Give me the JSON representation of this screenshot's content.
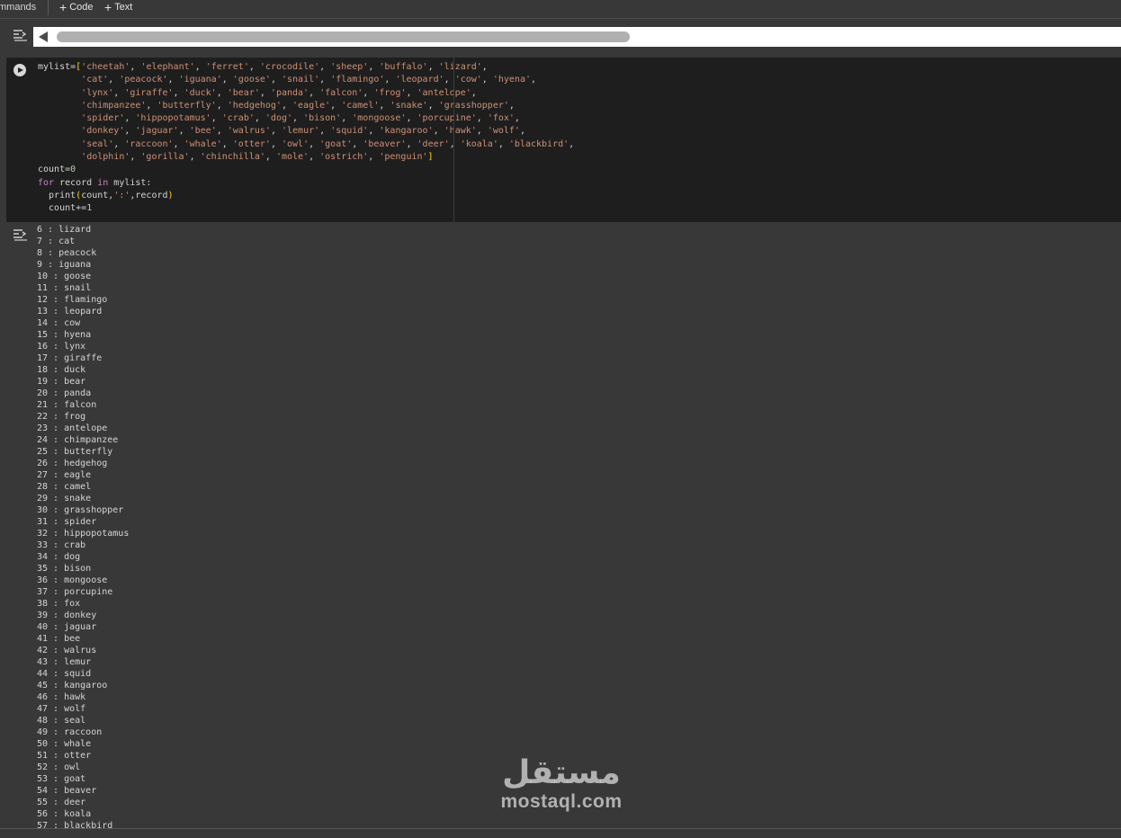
{
  "toolbar": {
    "commands_label": "mmands",
    "code_label": "Code",
    "text_label": "Text"
  },
  "icons": {
    "output_toggle": "output-collapse-icon",
    "run": "play-circle-icon",
    "scroll_left": "triangle-left-icon"
  },
  "colors": {
    "string": "#ce9178",
    "keyword": "#c586c0",
    "number": "#b5cea8",
    "bracket": "#ffd700"
  },
  "code": {
    "lines": [
      "mylist=['cheetah', 'elephant', 'ferret', 'crocodile', 'sheep', 'buffalo', 'lizard',",
      "        'cat', 'peacock', 'iguana', 'goose', 'snail', 'flamingo', 'leopard', 'cow', 'hyena',",
      "        'lynx', 'giraffe', 'duck', 'bear', 'panda', 'falcon', 'frog', 'antelope',",
      "        'chimpanzee', 'butterfly', 'hedgehog', 'eagle', 'camel', 'snake', 'grasshopper',",
      "        'spider', 'hippopotamus', 'crab', 'dog', 'bison', 'mongoose', 'porcupine', 'fox',",
      "        'donkey', 'jaguar', 'bee', 'walrus', 'lemur', 'squid', 'kangaroo', 'hawk', 'wolf',",
      "        'seal', 'raccoon', 'whale', 'otter', 'owl', 'goat', 'beaver', 'deer', 'koala', 'blackbird',",
      "        'dolphin', 'gorilla', 'chinchilla', 'mole', 'ostrich', 'penguin']",
      "count=0",
      "for record in mylist:",
      "  print(count,':',record)",
      "  count+=1"
    ]
  },
  "output": {
    "lines": [
      "6 : lizard",
      "7 : cat",
      "8 : peacock",
      "9 : iguana",
      "10 : goose",
      "11 : snail",
      "12 : flamingo",
      "13 : leopard",
      "14 : cow",
      "15 : hyena",
      "16 : lynx",
      "17 : giraffe",
      "18 : duck",
      "19 : bear",
      "20 : panda",
      "21 : falcon",
      "22 : frog",
      "23 : antelope",
      "24 : chimpanzee",
      "25 : butterfly",
      "26 : hedgehog",
      "27 : eagle",
      "28 : camel",
      "29 : snake",
      "30 : grasshopper",
      "31 : spider",
      "32 : hippopotamus",
      "33 : crab",
      "34 : dog",
      "35 : bison",
      "36 : mongoose",
      "37 : porcupine",
      "38 : fox",
      "39 : donkey",
      "40 : jaguar",
      "41 : bee",
      "42 : walrus",
      "43 : lemur",
      "44 : squid",
      "45 : kangaroo",
      "46 : hawk",
      "47 : wolf",
      "48 : seal",
      "49 : raccoon",
      "50 : whale",
      "51 : otter",
      "52 : owl",
      "53 : goat",
      "54 : beaver",
      "55 : deer",
      "56 : koala",
      "57 : blackbird"
    ]
  },
  "watermark": {
    "arabic": "مستقل",
    "latin": "mostaql.com"
  }
}
